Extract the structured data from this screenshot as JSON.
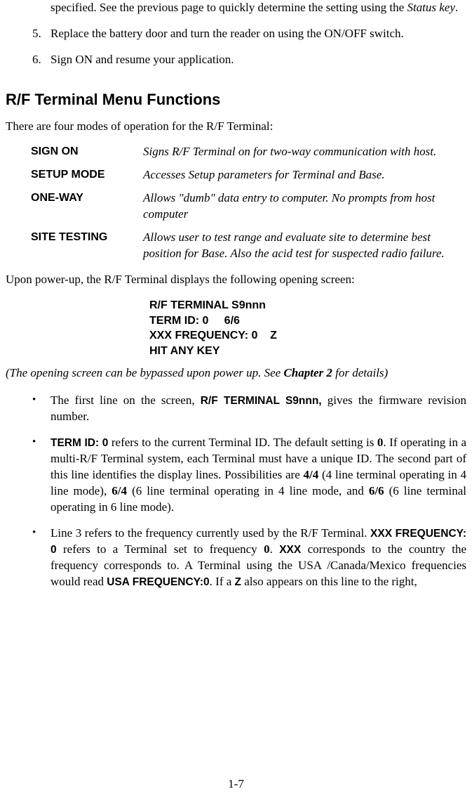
{
  "continuation": {
    "pre": "specified. See the previous page to quickly determine the setting using the ",
    "status_key": "Status key",
    "post": "."
  },
  "numbered": [
    {
      "num": "5.",
      "text": "Replace the battery door and turn the reader on using the ON/OFF switch."
    },
    {
      "num": "6.",
      "text": "Sign ON and resume your application."
    }
  ],
  "heading": "R/F Terminal Menu Functions",
  "intro": "There are four modes of operation for the R/F Terminal:",
  "modes": [
    {
      "name": "SIGN ON",
      "desc": "Signs R/F Terminal on for two-way communication with host."
    },
    {
      "name": "SETUP MODE",
      "desc": "Accesses Setup parameters for Terminal and Base."
    },
    {
      "name": "ONE-WAY",
      "desc": "Allows \"dumb\" data entry to computer. No prompts from host computer"
    },
    {
      "name": "SITE TESTING",
      "desc": "Allows user to test range and evaluate site to determine best position for Base. Also the acid test for suspected radio failure."
    }
  ],
  "powerup_intro": "Upon power-up, the R/F Terminal displays the following opening screen:",
  "screen": {
    "line1": "R/F TERMINAL S9nnn",
    "line2": "TERM ID: 0     6/6",
    "line3": "XXX FREQUENCY: 0    Z",
    "line4": "HIT ANY KEY"
  },
  "bypass": {
    "pre": "(The opening screen can be bypassed upon power up.  See ",
    "chapter": "Chapter 2",
    "post": " for details)"
  },
  "bullets": {
    "b1": {
      "p1": "The first line on the screen, ",
      "rfterm": "R/F TERMINAL S9nnn,",
      "p2": " gives the firmware revision number."
    },
    "b2": {
      "termid": "TERM ID: 0",
      "p1": " refers to the current Terminal ID.  The default setting is ",
      "zero": "0",
      "p2": ". If operating in a multi-R/F Terminal system, each Terminal must have a unique ID. The second part of this line identifies the display lines. Possibilities are ",
      "r44": "4/4",
      "p3": " (4 line terminal operating in 4 line mode), ",
      "r64": "6/4",
      "p4": " (6 line terminal operating in 4 line mode, and ",
      "r66": "6/6",
      "p5": " (6 line terminal operating in 6 line mode)."
    },
    "b3": {
      "p1": "Line 3 refers to the frequency currently used by the R/F Terminal. ",
      "xxxfreq0": "XXX FREQUENCY: 0",
      "p2": " refers to a Terminal set to frequency ",
      "zero": "0",
      "p3": ". ",
      "xxx": "XXX",
      "p4": " corresponds to the country the frequency corresponds to. A Terminal using the USA /Canada/Mexico frequencies would read ",
      "usafreq0": "USA FREQUENCY:0",
      "p5": ". If a ",
      "z": "Z",
      "p6": " also appears on this line to the right,"
    }
  },
  "page_number": "1-7"
}
